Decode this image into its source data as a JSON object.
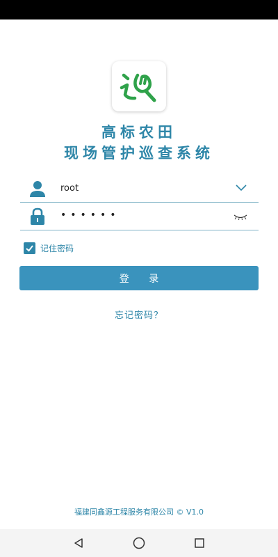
{
  "login": {
    "title_line1": "高标农田",
    "title_line2": "现场管护巡查系统",
    "username_value": "root",
    "password_value": "••••••",
    "remember_label": "记住密码",
    "remember_checked": true,
    "login_button": "登 录",
    "forgot_link": "忘记密码？"
  },
  "footer": {
    "copyright": "福建同鑫源工程服务有限公司 © V1.0"
  },
  "icons": {
    "logo": "patrol-logo-icon",
    "user": "user-icon",
    "lock": "lock-icon",
    "dropdown": "chevron-down-icon",
    "password_toggle": "eye-closed-icon",
    "check": "check-icon",
    "nav_back": "back-triangle-icon",
    "nav_home": "home-circle-icon",
    "nav_recents": "recents-square-icon"
  },
  "colors": {
    "accent": "#2e86a8",
    "button": "#3a93bd",
    "logo_green": "#2fa24a",
    "status_bar": "#000000",
    "nav_bar": "#f4f4f4"
  }
}
